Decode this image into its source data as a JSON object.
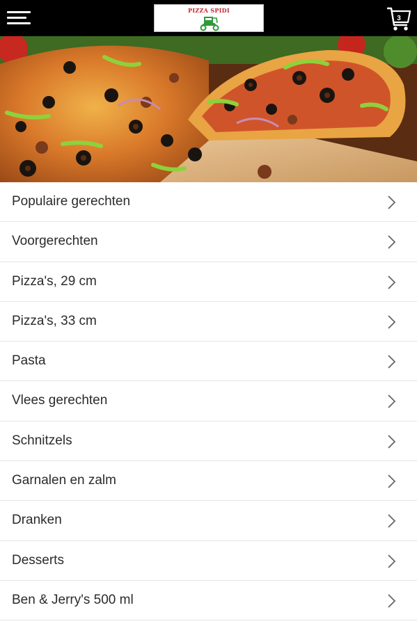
{
  "header": {
    "menu_icon": "hamburger-menu-icon",
    "logo_text": "PIZZA SPIDI",
    "cart_icon": "shopping-cart-icon",
    "cart_count": "3",
    "background_color": "#000000"
  },
  "hero": {
    "image": "pizza-photo"
  },
  "menu": {
    "chevron_icon": "chevron-right-icon",
    "items": [
      {
        "label": "Populaire gerechten"
      },
      {
        "label": "Voorgerechten"
      },
      {
        "label": "Pizza's, 29 cm"
      },
      {
        "label": "Pizza's, 33 cm"
      },
      {
        "label": "Pasta"
      },
      {
        "label": "Vlees gerechten"
      },
      {
        "label": "Schnitzels"
      },
      {
        "label": "Garnalen en zalm"
      },
      {
        "label": "Dranken"
      },
      {
        "label": "Desserts"
      },
      {
        "label": "Ben & Jerry's 500 ml"
      }
    ]
  },
  "colors": {
    "logo_red": "#c0282d",
    "logo_green": "#2e9a3a",
    "divider": "#e4e4e4"
  }
}
